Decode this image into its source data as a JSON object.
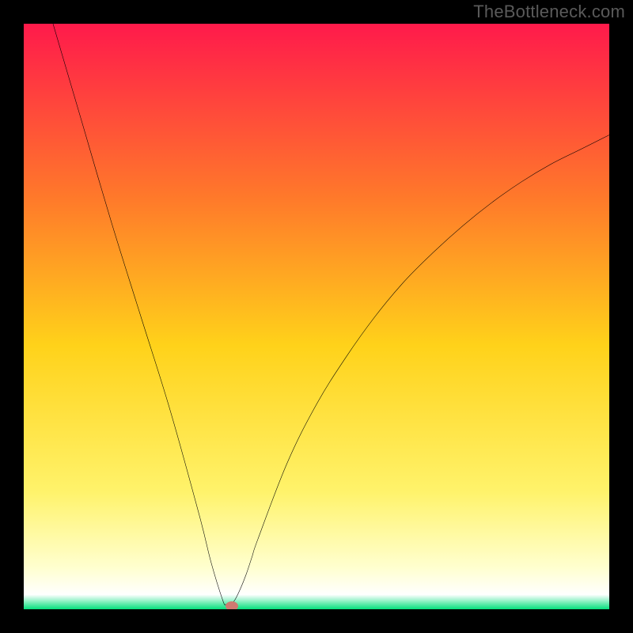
{
  "watermark": "TheBottleneck.com",
  "colors": {
    "frame_bg": "#000000",
    "grad_top": "#ff1a4b",
    "grad_mid_upper": "#ff7a2a",
    "grad_mid": "#ffd21a",
    "grad_mid_lower": "#fff36b",
    "grad_cream": "#ffffd0",
    "grad_green": "#05e07c",
    "curve_stroke": "#000000",
    "marker": "#cf7a71",
    "watermark": "#5a5a5a"
  },
  "chart_data": {
    "type": "line",
    "title": "",
    "xlabel": "",
    "ylabel": "",
    "xlim": [
      0,
      100
    ],
    "ylim": [
      0,
      100
    ],
    "series": [
      {
        "name": "bottleneck-curve",
        "x": [
          5,
          10,
          15,
          20,
          25,
          30,
          32,
          34,
          34.5,
          35,
          36,
          37,
          38,
          39,
          40,
          45,
          50,
          55,
          60,
          65,
          70,
          75,
          80,
          85,
          90,
          95,
          100
        ],
        "y": [
          100,
          83,
          66,
          50,
          34,
          16,
          8,
          1.5,
          0.8,
          0.5,
          1.5,
          3.5,
          6,
          9,
          12,
          25,
          35,
          43,
          50,
          56,
          61,
          65.5,
          69.5,
          73,
          76,
          78.5,
          81
        ]
      }
    ],
    "marker": {
      "x": 35.5,
      "y": 0.5,
      "name": "optimum-point"
    },
    "gradient_stops": [
      {
        "pos": 0.0,
        "color": "#ff1a4b"
      },
      {
        "pos": 0.3,
        "color": "#ff7a2a"
      },
      {
        "pos": 0.55,
        "color": "#ffd21a"
      },
      {
        "pos": 0.8,
        "color": "#fff36b"
      },
      {
        "pos": 0.93,
        "color": "#ffffd0"
      },
      {
        "pos": 0.975,
        "color": "#ffffff"
      },
      {
        "pos": 1.0,
        "color": "#05e07c"
      }
    ]
  }
}
